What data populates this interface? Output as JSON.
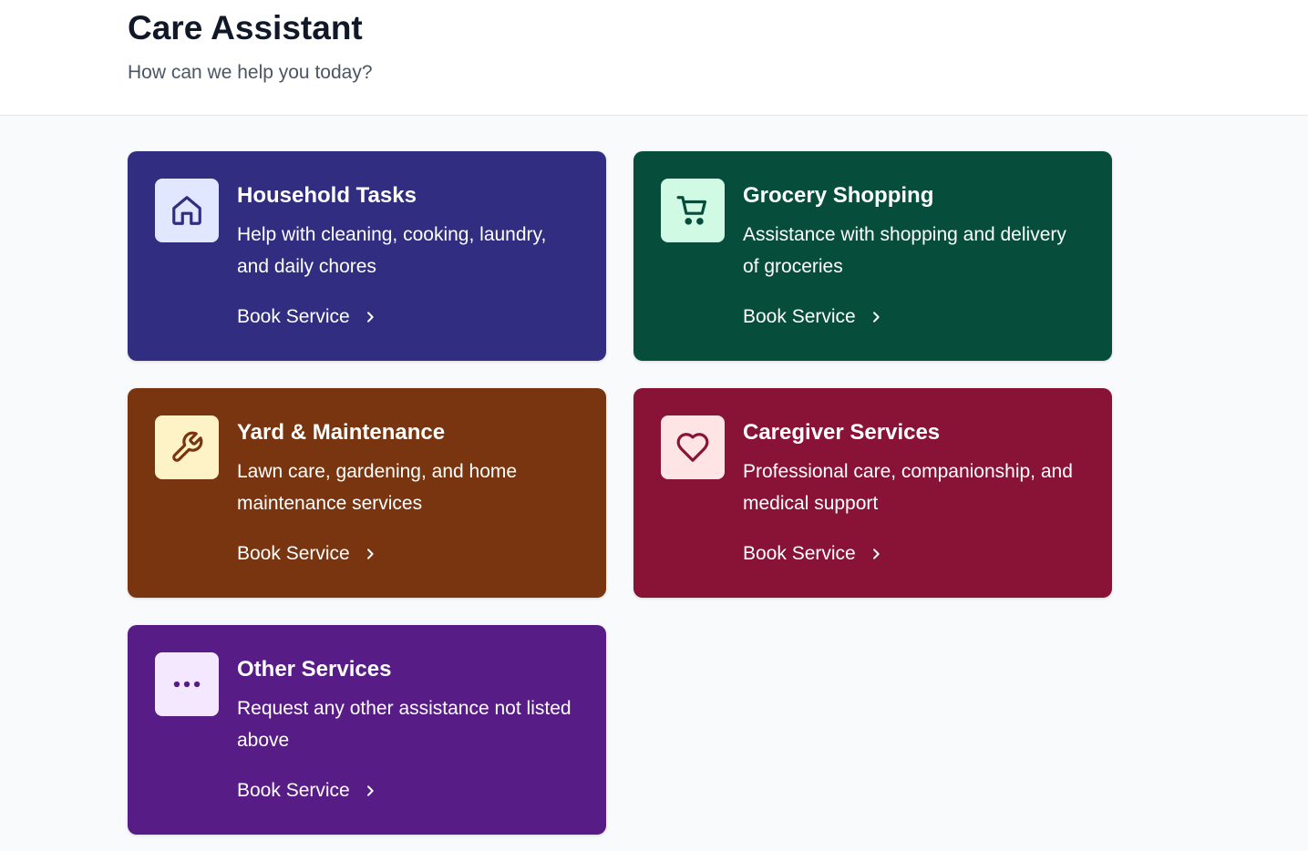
{
  "header": {
    "title": "Care Assistant",
    "subtitle": "How can we help you today?"
  },
  "services": [
    {
      "title": "Household Tasks",
      "description": "Help with cleaning, cooking, laundry, and daily chores",
      "action": "Book Service",
      "icon": "home-icon",
      "bg": "#312e81",
      "icon_bg": "#e0e7ff",
      "icon_color": "#312e81"
    },
    {
      "title": "Grocery Shopping",
      "description": "Assistance with shopping and delivery of groceries",
      "action": "Book Service",
      "icon": "cart-icon",
      "bg": "#064e3b",
      "icon_bg": "#d1fae5",
      "icon_color": "#064e3b"
    },
    {
      "title": "Yard & Maintenance",
      "description": "Lawn care, gardening, and home maintenance services",
      "action": "Book Service",
      "icon": "wrench-icon",
      "bg": "#78350f",
      "icon_bg": "#fef3c7",
      "icon_color": "#78350f"
    },
    {
      "title": "Caregiver Services",
      "description": "Professional care, companionship, and medical support",
      "action": "Book Service",
      "icon": "heart-icon",
      "bg": "#881337",
      "icon_bg": "#ffe4e6",
      "icon_color": "#881337"
    },
    {
      "title": "Other Services",
      "description": "Request any other assistance not listed above",
      "action": "Book Service",
      "icon": "more-icon",
      "bg": "#581c87",
      "icon_bg": "#f3e8ff",
      "icon_color": "#581c87"
    }
  ]
}
